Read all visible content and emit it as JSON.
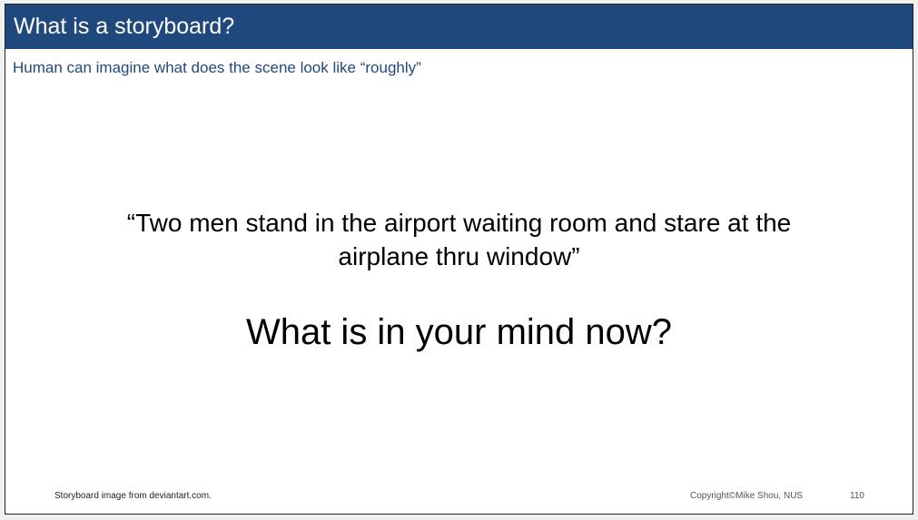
{
  "slide": {
    "title": "What is a storyboard?",
    "subtitle": "Human can imagine what does the scene look like “roughly”",
    "quote_line1": "“Two men stand in the airport waiting room and stare at the",
    "quote_line2": "airplane thru window”",
    "question": "What is in your mind now?",
    "footer_source": "Storyboard image from deviantart.com.",
    "footer_copyright": "Copyright©Mike Shou, NUS",
    "page_number": "110"
  },
  "colors": {
    "title_bar": "#1f497d",
    "subtitle_text": "#1f497d"
  }
}
